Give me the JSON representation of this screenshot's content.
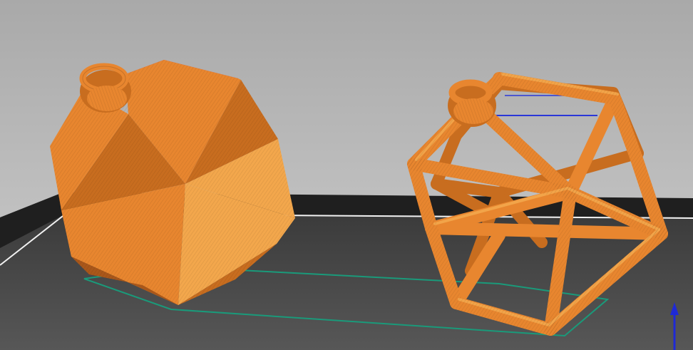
{
  "app": {
    "view": "layer-preview"
  },
  "colors": {
    "background_top": "#a9a9a9",
    "background_bottom": "#cfcfcf",
    "bed_edge": "#1f1f1f",
    "bed_surface_far": "#3b3b3b",
    "bed_surface_near": "#575757",
    "bed_outline": "#f2f2f2",
    "skirt": "#1a9a7a",
    "model_primary": "#e8862f",
    "model_light": "#f3a74c",
    "model_shadow": "#c86d1f",
    "model_dark": "#a9571a",
    "top_layer": "#e2353a",
    "travel": "#2a37d8",
    "axis_z": "#1e29d6"
  },
  "objects": [
    {
      "name": "solid-icosahedron-ornament",
      "style": "solid"
    },
    {
      "name": "wireframe-icosahedron-ornament",
      "style": "wireframe"
    }
  ],
  "axis_indicator": {
    "axis": "z",
    "icon": "arrow-up-icon"
  }
}
